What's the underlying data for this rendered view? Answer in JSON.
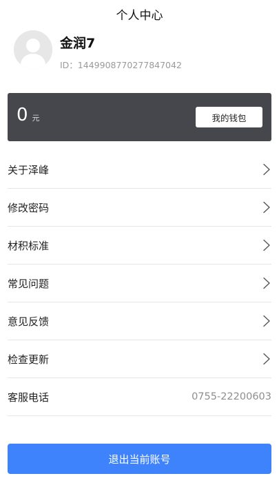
{
  "header": {
    "title": "个人中心"
  },
  "profile": {
    "avatar_icon": "person-placeholder-icon",
    "name": "金润7",
    "id_text": "ID：1449908770277847042"
  },
  "wallet": {
    "balance": "0",
    "unit": "元",
    "button_label": "我的钱包"
  },
  "menu": {
    "items": [
      {
        "label": "关于泽峰",
        "icon": "chevron-right-icon"
      },
      {
        "label": "修改密码",
        "icon": "chevron-right-icon"
      },
      {
        "label": "材积标准",
        "icon": "chevron-right-icon"
      },
      {
        "label": "常见问题",
        "icon": "chevron-right-icon"
      },
      {
        "label": "意见反馈",
        "icon": "chevron-right-icon"
      },
      {
        "label": "检查更新",
        "icon": "chevron-right-icon"
      },
      {
        "label": "客服电话",
        "value": "0755-22200603"
      }
    ]
  },
  "logout": {
    "label": "退出当前账号"
  },
  "colors": {
    "wallet_card": "#45474d",
    "logout_button": "#3e83fb",
    "divider": "#e6e6e6"
  }
}
